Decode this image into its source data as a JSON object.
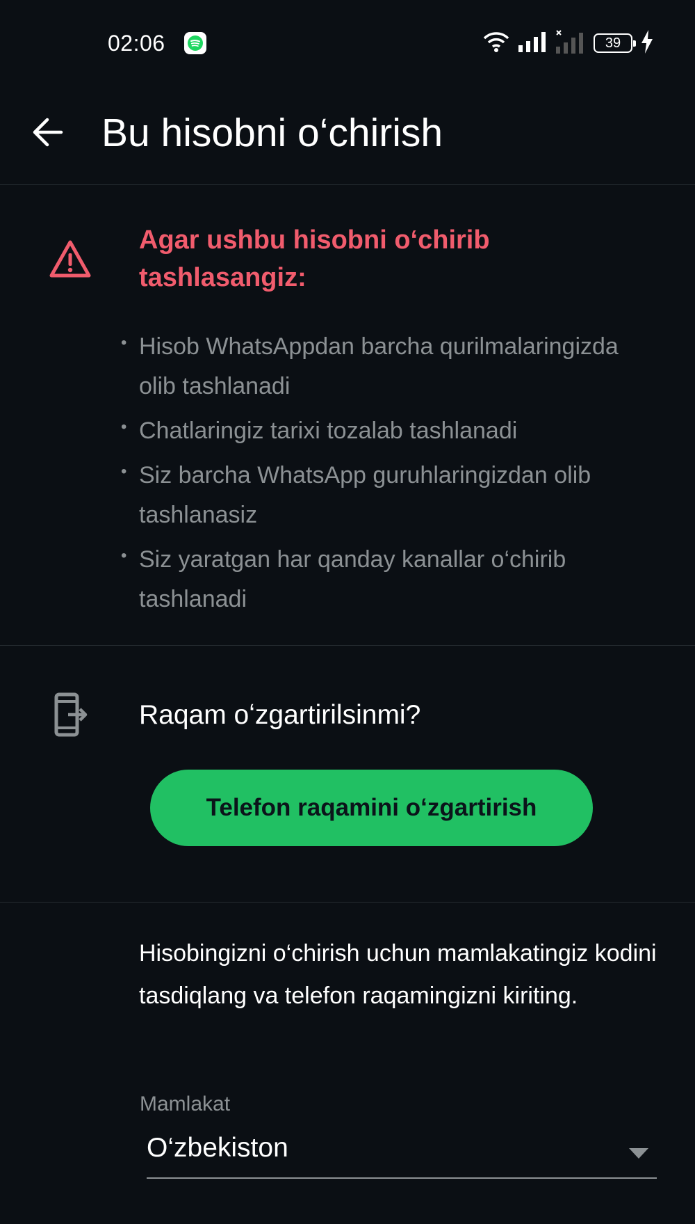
{
  "status_bar": {
    "time": "02:06",
    "battery": "39",
    "icons": [
      "spotify-icon",
      "wifi-icon",
      "signal-icon",
      "signal-no-service-icon",
      "battery-icon",
      "charging-icon"
    ]
  },
  "header": {
    "title": "Bu hisobni o‘chirish",
    "back_icon": "arrow-left-icon"
  },
  "warning": {
    "icon": "warning-triangle-icon",
    "title": "Agar ushbu hisobni o‘chirib tashlasangiz:",
    "items": [
      "Hisob WhatsAppdan barcha qurilmalaringizda olib tashlanadi",
      "Chatlaringiz tarixi tozalab tashlanadi",
      "Siz barcha WhatsApp guruhlaringizdan olib tashlanasiz",
      "Siz yaratgan har qanday kanallar o‘chirib tashlanadi"
    ]
  },
  "change_number": {
    "icon": "phone-exit-icon",
    "question": "Raqam oʻzgartirilsinmi?",
    "button_label": "Telefon raqamini oʻzgartirish"
  },
  "delete_form": {
    "instruction": "Hisobingizni o‘chirish uchun mamlakatingiz kodini tasdiqlang va telefon raqamingizni kiriting.",
    "country_label": "Mamlakat",
    "country_value": "O‘zbekiston"
  },
  "colors": {
    "background": "#0b0f14",
    "warning": "#f15c6d",
    "accent": "#21c063",
    "secondary_text": "#8c9194",
    "divider": "#262c31"
  }
}
